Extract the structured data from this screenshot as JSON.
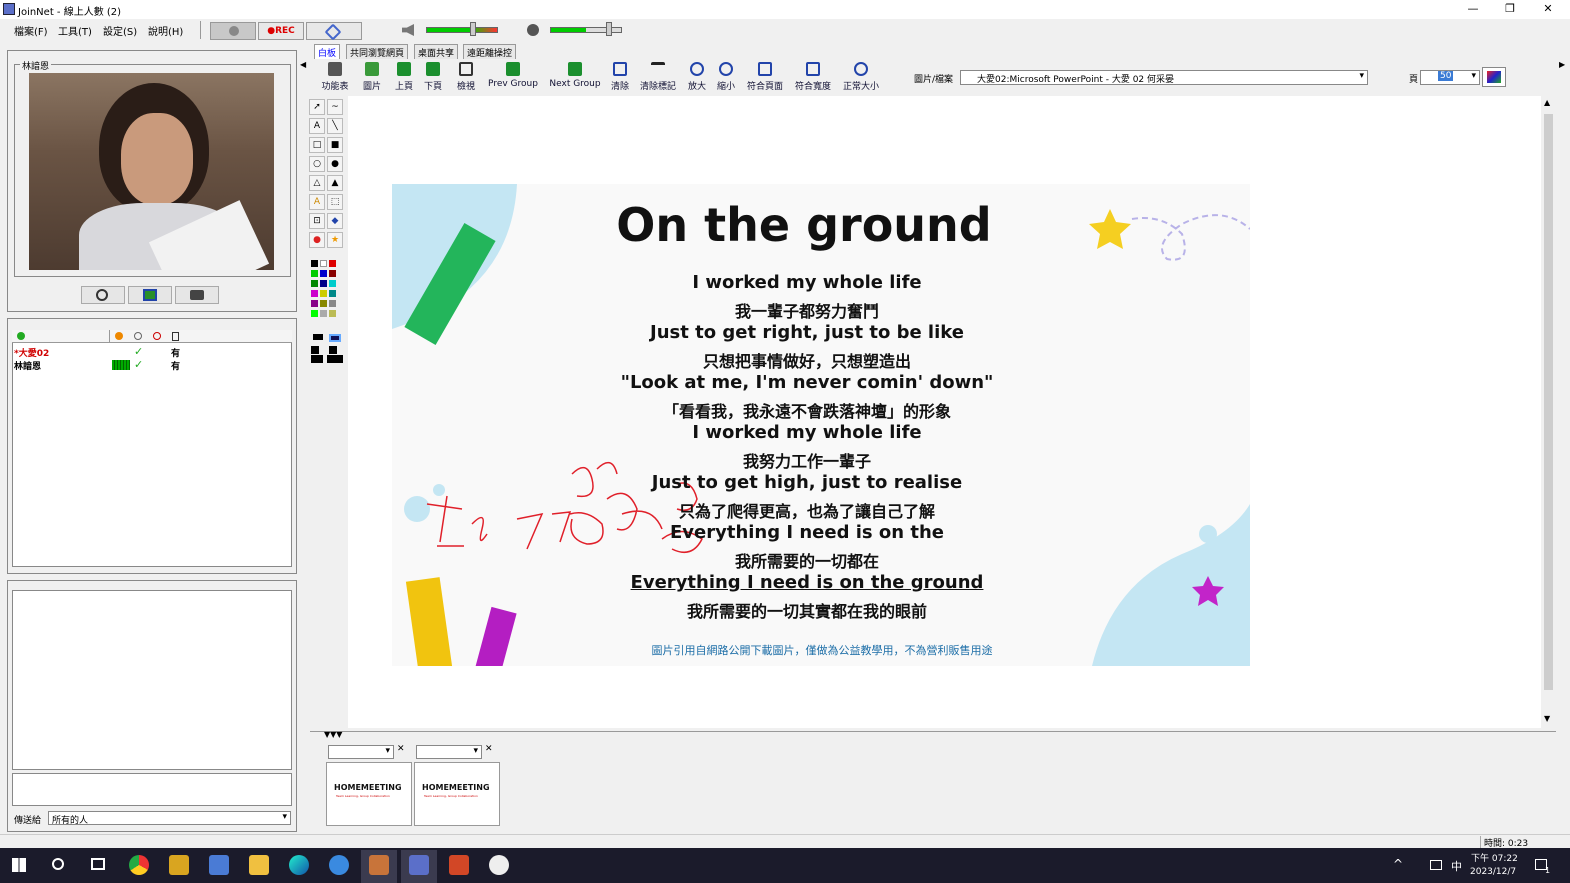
{
  "window": {
    "title": "JoinNet - 線上人數 (2)",
    "min": "—",
    "max": "❐",
    "close": "✕"
  },
  "menu": [
    "檔案(F)",
    "工具(T)",
    "設定(S)",
    "說明(H)"
  ],
  "toolbar": {
    "rec": "●REC"
  },
  "left": {
    "participant_name": "林諳恩",
    "users": [
      {
        "name": "*大愛02",
        "status": "有",
        "color": "#d00000"
      },
      {
        "name": "林諳恩",
        "status": "有",
        "color": "#000000"
      }
    ],
    "send_to_label": "傳送給",
    "send_to_value": "所有的人"
  },
  "tabs": [
    "白板",
    "共同瀏覽網頁",
    "桌面共享",
    "遠距離操控"
  ],
  "tools": [
    "功能表",
    "圖片",
    "上頁",
    "下頁",
    "檢視",
    "Prev Group",
    "Next Group",
    "清除",
    "清除標記",
    "放大",
    "縮小",
    "符合頁面",
    "符合寬度",
    "正常大小"
  ],
  "file": {
    "label": "圖片/檔案",
    "value": "大愛02:Microsoft PowerPoint - 大愛 02 何采晏"
  },
  "page": {
    "label": "頁",
    "value": "50"
  },
  "slide": {
    "title": "On the ground",
    "lines": [
      "I worked my whole life",
      "我一輩子都努力奮鬥",
      "Just to get right, just to be like",
      "只想把事情做好，只想塑造出",
      "\"Look at me, I'm never comin' down\"",
      "「看看我，我永遠不會跌落神壇」的形象",
      "I worked my whole life",
      "我努力工作一輩子",
      "Just to get high, just to realise",
      "只為了爬得更高，也為了讓自己了解",
      "Everything I need is on the",
      "我所需要的一切都在",
      "Everything I need is on the ground",
      "我所需要的一切其實都在我的眼前"
    ],
    "footer": "圖片引用自網路公開下載圖片，僅做為公益教學用，不為營利販售用途"
  },
  "thumbs": [
    {
      "brand": "HOMEMEETING",
      "tagline": "Team Learning, Group Collaboration"
    },
    {
      "brand": "HOMEMEETING",
      "tagline": "Team Learning, Group Collaboration"
    }
  ],
  "status": {
    "time": "時間: 0:23"
  },
  "taskbar": {
    "ime": "中",
    "time": "下午 07:22",
    "date": "2023/12/7",
    "notif": "1"
  }
}
